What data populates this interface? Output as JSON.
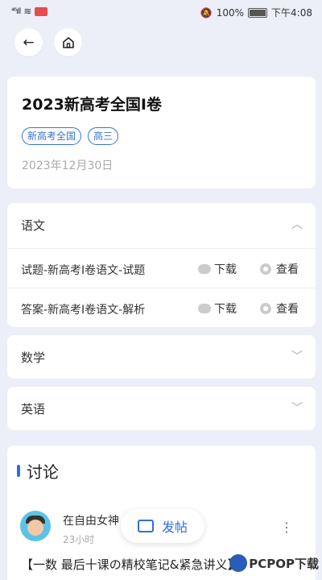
{
  "status_bar": {
    "signal": "⁴⁶ıll",
    "battery_percent": "100%",
    "time": "下午4:08"
  },
  "nav": {
    "back_icon": "arrow-left-icon",
    "home_icon": "home-icon"
  },
  "paper": {
    "title": "2023新高考全国I卷",
    "tags": [
      "新高考全国",
      "高三"
    ],
    "date": "2023年12月30日"
  },
  "subjects": [
    {
      "name": "语文",
      "expanded": true,
      "files": [
        {
          "name": "试题-新高考I卷语文-试题",
          "download_label": "下载",
          "view_label": "查看"
        },
        {
          "name": "答案-新高考I卷语文-解析",
          "download_label": "下载",
          "view_label": "查看"
        }
      ]
    },
    {
      "name": "数学",
      "expanded": false
    },
    {
      "name": "英语",
      "expanded": false
    }
  ],
  "discussion": {
    "title": "讨论",
    "post": {
      "user": "在自由女神",
      "time": "23小时",
      "text": "【一数 最后十课の精校笔记&紧急讲义】"
    }
  },
  "fab": {
    "label": "发帖"
  },
  "watermark": "PCPOP下载",
  "colors": {
    "accent": "#2f6fe0",
    "tag": "#3b73c7",
    "background": "#eceef8"
  }
}
